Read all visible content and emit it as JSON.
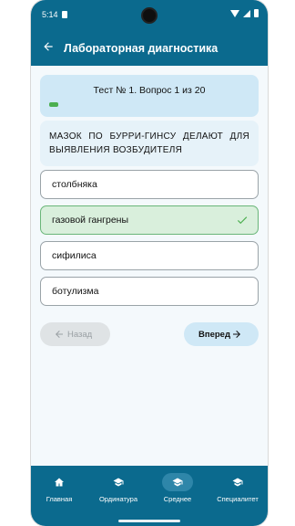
{
  "status": {
    "time": "5:14"
  },
  "appbar": {
    "title": "Лабораторная диагностика"
  },
  "test": {
    "header": "Тест № 1. Вопрос 1 из 20",
    "progress_fraction": 0.05
  },
  "question": {
    "text": "МАЗОК ПО БУРРИ-ГИНСУ ДЕЛАЮТ ДЛЯ ВЫЯВЛЕНИЯ ВОЗБУДИТЕЛЯ"
  },
  "answers": [
    {
      "label": "столбняка",
      "state": "default"
    },
    {
      "label": "газовой гангрены",
      "state": "correct"
    },
    {
      "label": "сифилиса",
      "state": "default"
    },
    {
      "label": "ботулизма",
      "state": "default"
    }
  ],
  "buttons": {
    "back": "Назад",
    "next": "Вперед"
  },
  "bottom_nav": [
    {
      "label": "Главная",
      "icon": "home-icon"
    },
    {
      "label": "Ординатура",
      "icon": "graduation-cap-icon"
    },
    {
      "label": "Среднее",
      "icon": "graduation-cap-icon",
      "active": true
    },
    {
      "label": "Специалитет",
      "icon": "graduation-cap-icon"
    }
  ],
  "colors": {
    "primary": "#0b6a8e",
    "light_blue": "#cfe8f6",
    "correct_green": "#4caf50",
    "correct_bg": "#d9efdc"
  }
}
